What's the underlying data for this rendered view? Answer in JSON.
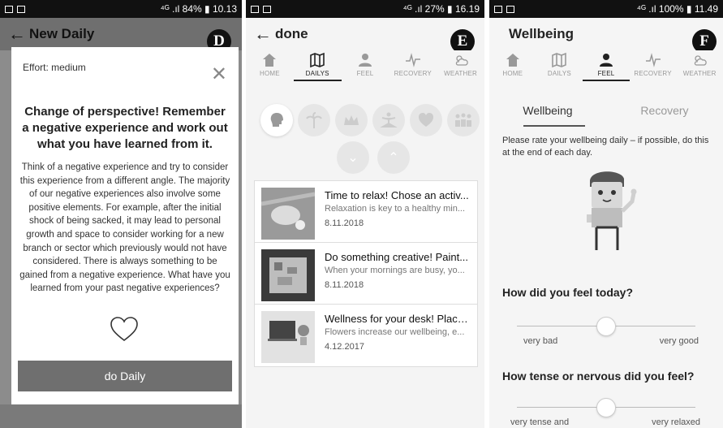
{
  "panel_d": {
    "status": {
      "right": "⁴ᴳ .ıl 84% ▮ 10.13"
    },
    "title": "New Daily",
    "badge": "D",
    "dialog": {
      "effort": "Effort: medium",
      "close": "✕",
      "heading": "Change of perspective! Remember a negative experience and work out what you have learned from it.",
      "body": "Think of a negative experience and try to consider this experience from a different angle. The majority of our negative experiences also involve some positive elements. For example, after the initial shock of being sacked, it may lead to personal growth and space to consider working for a new branch or sector which previously would not have considered. There is always something to be gained from a negative experience. What have you learned from your past negative experiences?",
      "button": "do Daily"
    }
  },
  "panel_e": {
    "status": {
      "right": "⁴ᴳ .ıl 27% ▮ 16.19"
    },
    "title": "done",
    "badge": "E",
    "tabs": [
      {
        "label": "HOME",
        "icon": "home-icon"
      },
      {
        "label": "DAILYS",
        "icon": "map-icon"
      },
      {
        "label": "FEEL",
        "icon": "person-icon"
      },
      {
        "label": "RECOVERY",
        "icon": "pulse-icon"
      },
      {
        "label": "WEATHER",
        "icon": "weather-icon"
      }
    ],
    "active_tab": "DAILYS",
    "category_icons": [
      "head-icon",
      "palm-tree-icon",
      "crown-icon",
      "yoga-icon",
      "heart-icon",
      "people-icon"
    ],
    "cards": [
      {
        "title": "Time to relax! Chose an activ...",
        "subtitle": "Relaxation is key to a healthy min...",
        "date": "8.11.2018"
      },
      {
        "title": "Do something creative! Paint...",
        "subtitle": "When your mornings are busy, yo...",
        "date": "8.11.2018"
      },
      {
        "title": "Wellness for your desk! Place...",
        "subtitle": "Flowers increase our wellbeing, e...",
        "date": "4.12.2017"
      }
    ]
  },
  "panel_f": {
    "status": {
      "right": "⁴ᴳ .ıl 100% ▮ 11.49"
    },
    "title": "Wellbeing",
    "badge": "F",
    "tabs": [
      {
        "label": "HOME",
        "icon": "home-icon"
      },
      {
        "label": "DAILYS",
        "icon": "map-icon"
      },
      {
        "label": "FEEL",
        "icon": "person-icon"
      },
      {
        "label": "RECOVERY",
        "icon": "pulse-icon"
      },
      {
        "label": "WEATHER",
        "icon": "weather-icon"
      }
    ],
    "active_tab": "FEEL",
    "subtabs": [
      "Wellbeing",
      "Recovery"
    ],
    "intro": "Please rate your wellbeing daily – if possible, do this at the end of each day.",
    "questions": [
      {
        "text": "How did you feel today?",
        "low": "very bad",
        "high": "very good",
        "value": 0.5
      },
      {
        "text": "How tense or nervous did you feel?",
        "low": "very tense and",
        "high": "very relaxed",
        "value": 0.5
      }
    ]
  }
}
